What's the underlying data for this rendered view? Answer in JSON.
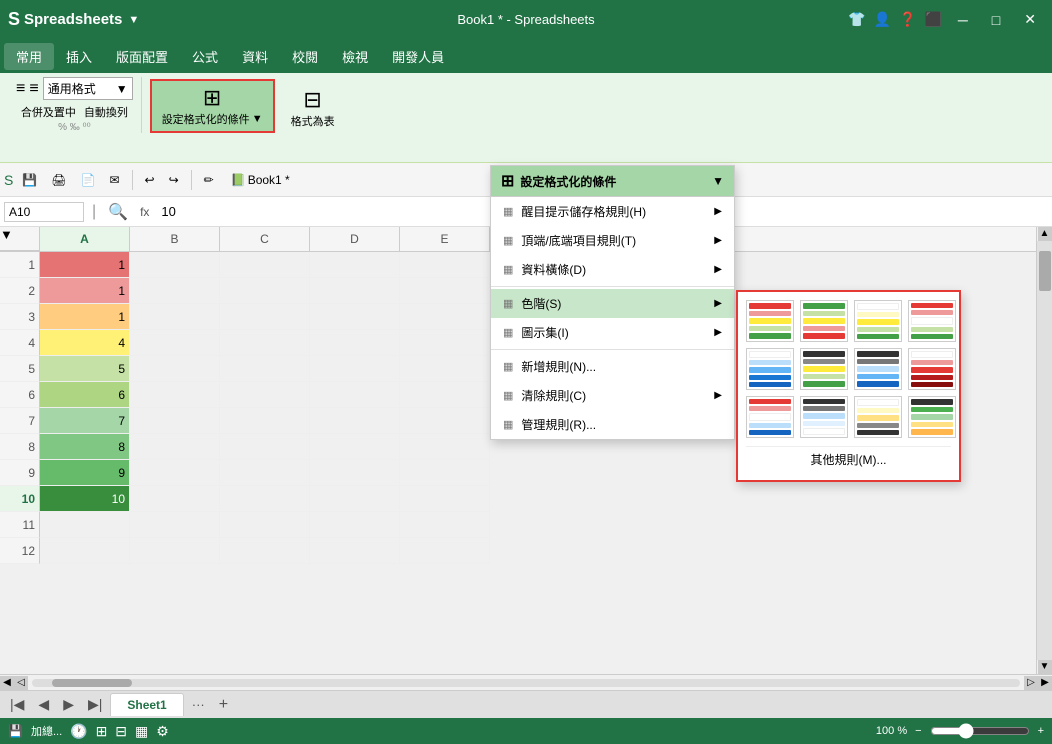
{
  "app": {
    "title": "Book1 * - Spreadsheets",
    "logo": "S",
    "logo_text": "Spreadsheets"
  },
  "titlebar": {
    "window_controls": [
      "─",
      "□",
      "✕"
    ],
    "icons": [
      "👕",
      "👤",
      "?",
      "⬛"
    ]
  },
  "menubar": {
    "items": [
      "常用",
      "插入",
      "版面配置",
      "公式",
      "資料",
      "校閱",
      "檢視",
      "開發人員"
    ]
  },
  "ribbon": {
    "format_label": "通用格式",
    "merge_label": "合併及置中",
    "wrap_label": "自動換列",
    "conditional_format_label": "設定格式化的條件",
    "format_as_label": "格式為表"
  },
  "toolbar": {
    "items": [
      "💾",
      "🖨",
      "↩",
      "↪",
      "✏"
    ]
  },
  "formula_bar": {
    "cell_ref": "A10",
    "fx": "fx",
    "value": "10"
  },
  "columns": [
    "A",
    "B",
    "C",
    "D",
    "E"
  ],
  "rows": [
    {
      "num": 1,
      "a": "1",
      "color": "red-dark"
    },
    {
      "num": 2,
      "a": "1",
      "color": "red-light"
    },
    {
      "num": 3,
      "a": "1",
      "color": "orange"
    },
    {
      "num": 4,
      "a": "4",
      "color": "yellow"
    },
    {
      "num": 5,
      "a": "5",
      "color": "light-green"
    },
    {
      "num": 6,
      "a": "6",
      "color": "green-2"
    },
    {
      "num": 7,
      "a": "7",
      "color": "green-3"
    },
    {
      "num": 8,
      "a": "8",
      "color": "green-4"
    },
    {
      "num": 9,
      "a": "9",
      "color": "green-5"
    },
    {
      "num": 10,
      "a": "10",
      "color": "green-dark"
    },
    {
      "num": 11,
      "a": "",
      "color": ""
    },
    {
      "num": 12,
      "a": "",
      "color": ""
    }
  ],
  "dropdown": {
    "header_label": "設定格式化的條件",
    "items": [
      {
        "label": "醒目提示儲存格規則(H)",
        "icon": "▦",
        "has_arrow": true
      },
      {
        "label": "頂端/底端項目規則(T)",
        "icon": "▦",
        "has_arrow": true
      },
      {
        "label": "資料橫條(D)",
        "icon": "▦",
        "has_arrow": true
      },
      {
        "label": "色階(S)",
        "icon": "▦",
        "has_arrow": true,
        "selected": true
      },
      {
        "label": "圖示集(I)",
        "icon": "▦",
        "has_arrow": true
      },
      {
        "label": "新增規則(N)...",
        "icon": "▦"
      },
      {
        "label": "清除規則(C)",
        "icon": "▦",
        "has_arrow": true
      },
      {
        "label": "管理規則(R)...",
        "icon": "▦"
      }
    ]
  },
  "color_scales": [
    [
      {
        "c": "#e53935"
      },
      {
        "c": "#ffeb3b"
      },
      {
        "c": "#43a047"
      }
    ],
    [
      {
        "c": "#43a047"
      },
      {
        "c": "#ffeb3b"
      },
      {
        "c": "#e53935"
      }
    ],
    [
      {
        "c": "#ffffff"
      },
      {
        "c": "#ffeb3b"
      },
      {
        "c": "#43a047"
      }
    ],
    [
      {
        "c": "#e53935"
      },
      {
        "c": "#ffffff"
      },
      {
        "c": "#43a047"
      }
    ],
    [
      {
        "c": "#ffffff"
      },
      {
        "c": "#43a047"
      },
      {
        "c": "#1565c0"
      }
    ],
    [
      {
        "c": "#333333"
      },
      {
        "c": "#ffeb3b"
      },
      {
        "c": "#43a047"
      }
    ],
    [
      {
        "c": "#333333"
      },
      {
        "c": "#bbdefb"
      },
      {
        "c": "#1565c0"
      }
    ],
    [
      {
        "c": "#ffffff"
      },
      {
        "c": "#bbdefb"
      },
      {
        "c": "#e53935"
      }
    ],
    [
      {
        "c": "#e53935"
      },
      {
        "c": "#ffffff"
      },
      {
        "c": "#1565c0"
      }
    ],
    [
      {
        "c": "#333333"
      },
      {
        "c": "#bbdefb"
      },
      {
        "c": "#ffffff"
      }
    ],
    [
      {
        "c": "#ffffff"
      },
      {
        "c": "#ffe082"
      },
      {
        "c": "#333333"
      }
    ],
    [
      {
        "c": "#333333"
      },
      {
        "c": "#43a047"
      },
      {
        "c": "#ffe082"
      }
    ]
  ],
  "other_rules_label": "其他規則(M)...",
  "sheet_tabs": [
    "Sheet1"
  ],
  "status_bar": {
    "sum_label": "加總...",
    "zoom": "100 %",
    "view_icons": [
      "⊞",
      "⊟",
      "▦"
    ]
  }
}
